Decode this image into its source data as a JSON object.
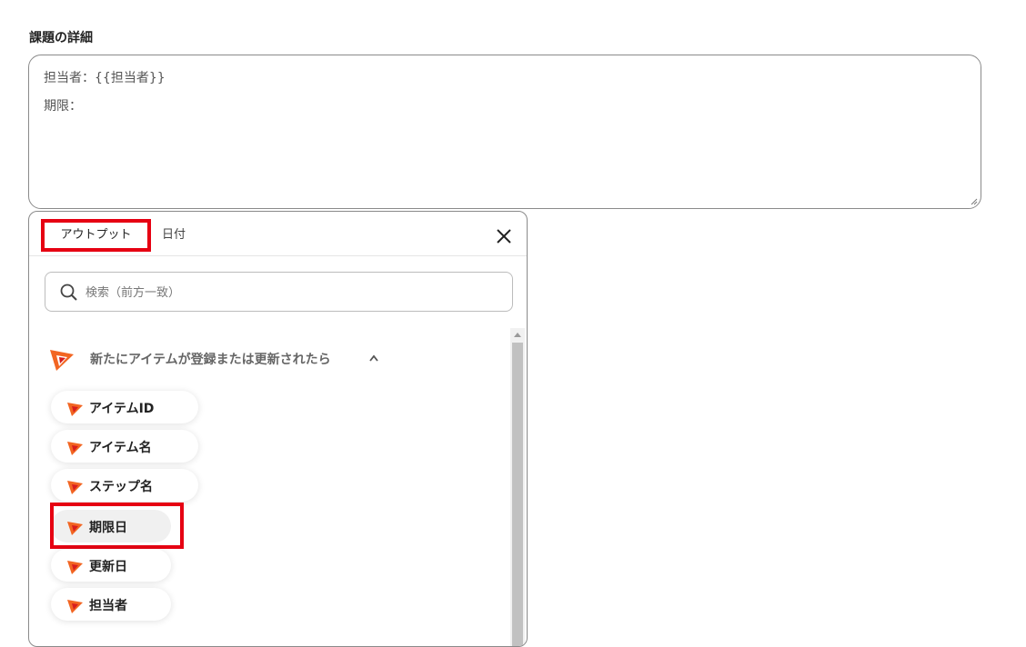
{
  "section": {
    "label": "課題の詳細"
  },
  "description": {
    "lines": [
      "担当者：{{担当者}}",
      "期限："
    ]
  },
  "panel": {
    "tabs": [
      {
        "label": "アウトプット",
        "active": true
      },
      {
        "label": "日付",
        "active": false
      }
    ],
    "search_placeholder": "検索（前方一致）",
    "group": {
      "title": "新たにアイテムが登録または更新されたら",
      "expanded": true,
      "items": [
        {
          "label": "アイテムID"
        },
        {
          "label": "アイテム名"
        },
        {
          "label": "ステップ名"
        },
        {
          "label": "期限日",
          "selected": true
        },
        {
          "label": "更新日"
        },
        {
          "label": "担当者"
        }
      ]
    }
  },
  "colors": {
    "highlight": "#e60012",
    "brand_orange": "#f26522",
    "brand_red": "#d81e1e"
  }
}
